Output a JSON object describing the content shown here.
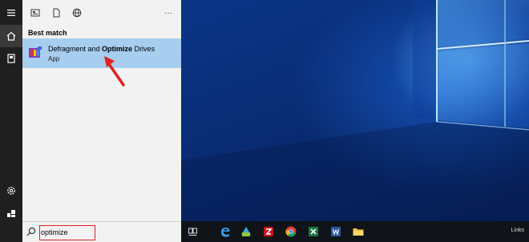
{
  "search_panel": {
    "section_header": "Best match",
    "result": {
      "name_prefix": "Defragment and ",
      "name_bold": "Optimize",
      "name_suffix": " Drives",
      "subtitle": "App"
    },
    "more_label": "···"
  },
  "search_bar": {
    "value": "optimize"
  },
  "taskbar": {
    "links_label": "Links"
  },
  "colors": {
    "highlight": "#a7cdef",
    "annotation_red": "#e02020",
    "taskbar": "#101418"
  },
  "icons": [
    "hamburger-icon",
    "home-icon",
    "documents-icon",
    "settings-icon",
    "power-icon",
    "apps-filter-icon",
    "documents-filter-icon",
    "web-filter-icon",
    "defrag-app-icon",
    "search-icon",
    "task-view-icon",
    "edge-icon",
    "store-icon",
    "filezilla-icon",
    "chrome-icon",
    "excel-icon",
    "word-icon",
    "file-explorer-icon"
  ]
}
